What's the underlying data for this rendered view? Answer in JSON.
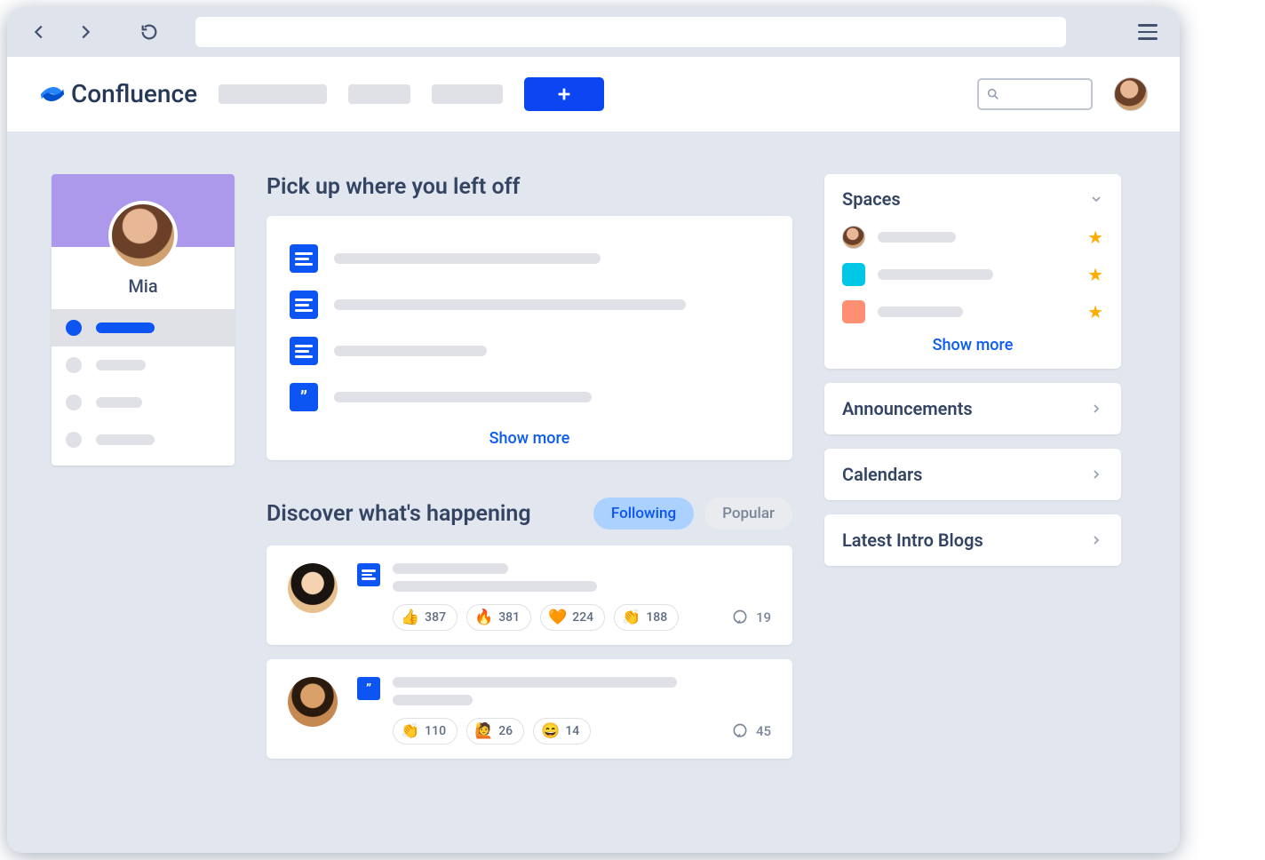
{
  "app_name": "Confluence",
  "profile": {
    "name": "Mia"
  },
  "sections": {
    "recents_title": "Pick up where you left off",
    "recents_show_more": "Show more",
    "discover_title": "Discover what's happening"
  },
  "tabs": {
    "following": "Following",
    "popular": "Popular"
  },
  "feed": [
    {
      "type": "doc",
      "reactions": [
        {
          "emoji": "👍",
          "count": 387
        },
        {
          "emoji": "🔥",
          "count": 381
        },
        {
          "emoji": "🧡",
          "count": 224
        },
        {
          "emoji": "👏",
          "count": 188
        }
      ],
      "comments": 19
    },
    {
      "type": "quote",
      "reactions": [
        {
          "emoji": "👏",
          "count": 110
        },
        {
          "emoji": "🙋",
          "count": 26
        },
        {
          "emoji": "😄",
          "count": 14
        }
      ],
      "comments": 45
    }
  ],
  "sidebar": {
    "spaces_title": "Spaces",
    "spaces_show_more": "Show more",
    "announcements": "Announcements",
    "calendars": "Calendars",
    "latest_intro_blogs": "Latest Intro Blogs"
  },
  "space_colors": [
    "avatar",
    "#00C7E5",
    "#FF8F73"
  ]
}
